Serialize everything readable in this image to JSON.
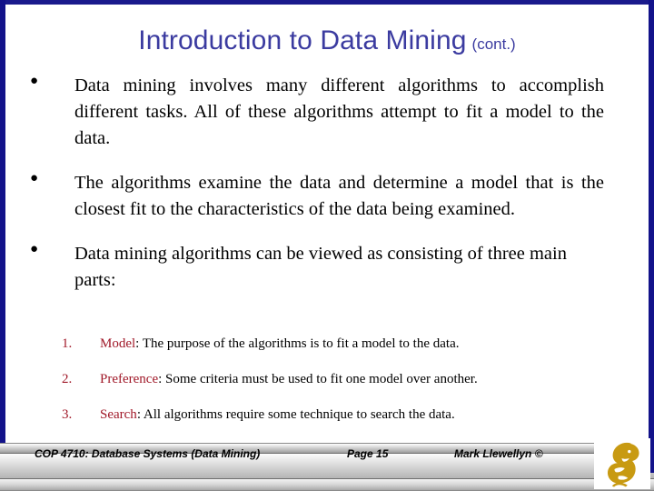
{
  "slide": {
    "title_main": "Introduction to Data Mining",
    "title_cont": "(cont.)",
    "title_color": "#3b3ba0",
    "accent_border_color": "#12128a",
    "bullet_glyph": "●",
    "bullets": [
      {
        "marker": "●",
        "text": "Data mining involves many different algorithms to accomplish different tasks.  All of these algorithms attempt to fit a model to the data."
      },
      {
        "marker": "●",
        "text": "The algorithms examine the data and determine a model that is the closest fit to the characteristics of the data being examined."
      },
      {
        "marker": "●",
        "text": "Data mining algorithms can be viewed as consisting of three main parts:"
      }
    ],
    "numbered_items": [
      {
        "marker": "1.",
        "keyword": "Model",
        "rest": ":  The purpose of the algorithms is to fit a model to the data."
      },
      {
        "marker": "2.",
        "keyword": "Preference",
        "rest": ": Some criteria must be used to fit one model over another."
      },
      {
        "marker": "3.",
        "keyword": "Search",
        "rest": ": All algorithms require some technique to search the data."
      }
    ],
    "numbered_keyword_color": "#a01828"
  },
  "footer": {
    "course": "COP 4710: Database Systems  (Data Mining)",
    "page": "Page 15",
    "author": "Mark Llewellyn ©",
    "logo_name": "ucf-pegasus-logo",
    "logo_color": "#c89a12"
  }
}
